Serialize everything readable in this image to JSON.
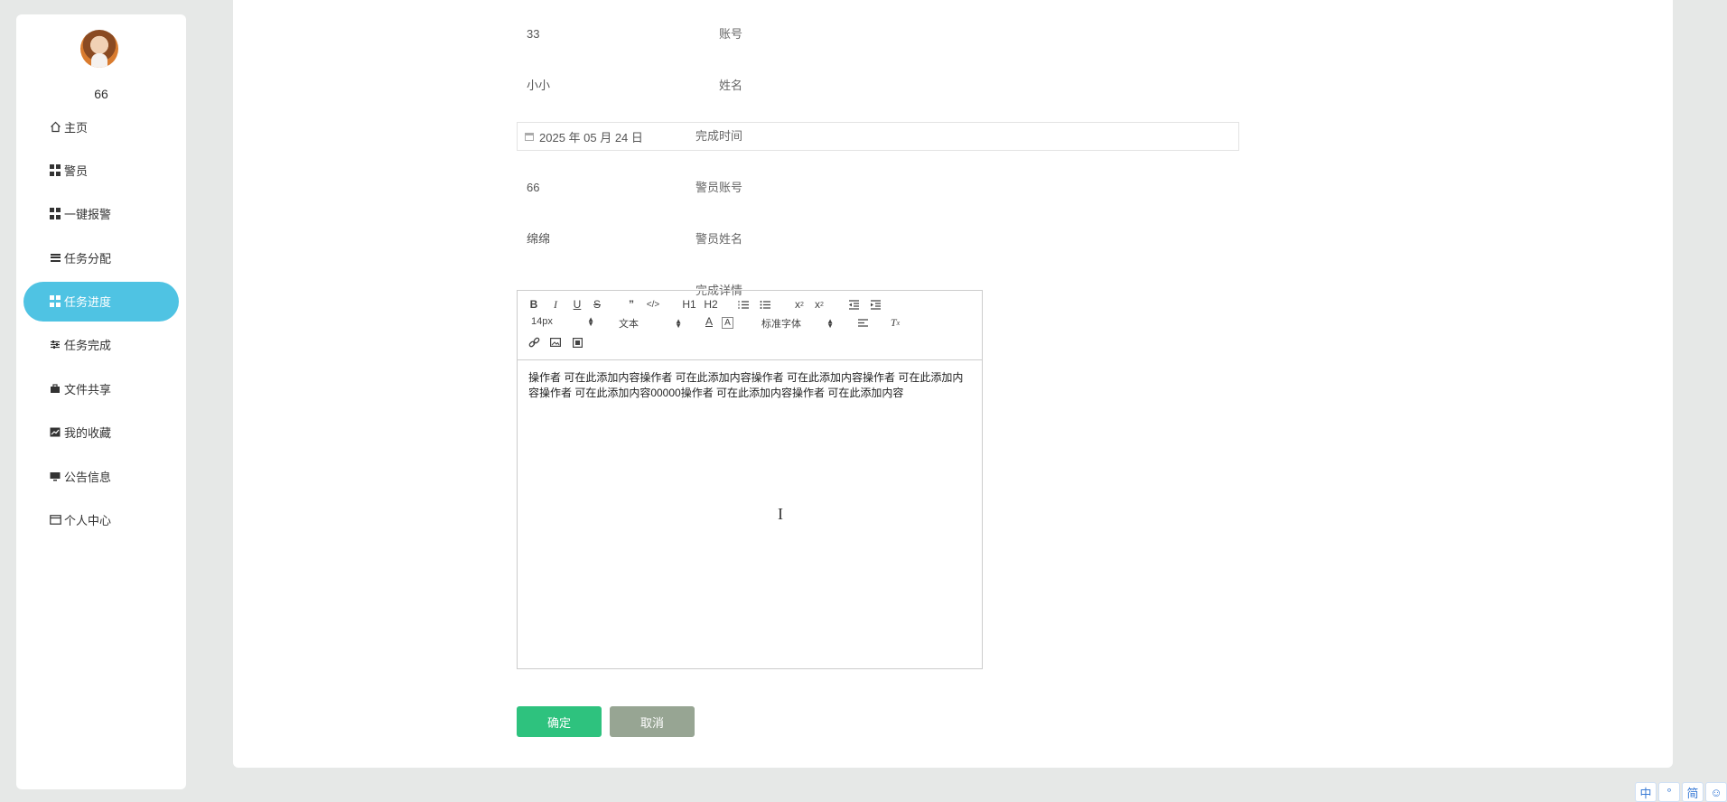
{
  "sidebar": {
    "username": "66",
    "menu": [
      {
        "label": "主页",
        "icon": "home-icon"
      },
      {
        "label": "警员",
        "icon": "grid-icon"
      },
      {
        "label": "一键报警",
        "icon": "grid-icon"
      },
      {
        "label": "任务分配",
        "icon": "list-icon"
      },
      {
        "label": "任务进度",
        "icon": "grid-icon",
        "active": true
      },
      {
        "label": "任务完成",
        "icon": "sliders-icon"
      },
      {
        "label": "文件共享",
        "icon": "briefcase-icon"
      },
      {
        "label": "我的收藏",
        "icon": "chart-icon"
      },
      {
        "label": "公告信息",
        "icon": "monitor-icon"
      },
      {
        "label": "个人中心",
        "icon": "card-icon"
      }
    ]
  },
  "form": {
    "account": {
      "label": "账号",
      "value": "33"
    },
    "name": {
      "label": "姓名",
      "value": "小小"
    },
    "finish_time": {
      "label": "完成时间",
      "value": "2025 年 05 月 24 日"
    },
    "officer_account": {
      "label": "警员账号",
      "value": "66"
    },
    "officer_name": {
      "label": "警员姓名",
      "value": "绵绵"
    },
    "details": {
      "label": "完成详情"
    }
  },
  "editor": {
    "font_size": "14px",
    "header_select": "文本",
    "font_family": "标准字体",
    "content": "操作者 可在此添加内容操作者 可在此添加内容操作者 可在此添加内容操作者 可在此添加内容操作者 可在此添加内容00000操作者 可在此添加内容操作者 可在此添加内容",
    "h1": "H1",
    "h2": "H2"
  },
  "buttons": {
    "confirm": "确定",
    "cancel": "取消"
  },
  "corner": [
    "中",
    "°",
    "简",
    "☺"
  ],
  "colors": {
    "active": "#4fc3e3",
    "confirm": "#2ec27e",
    "cancel": "#97a593"
  }
}
